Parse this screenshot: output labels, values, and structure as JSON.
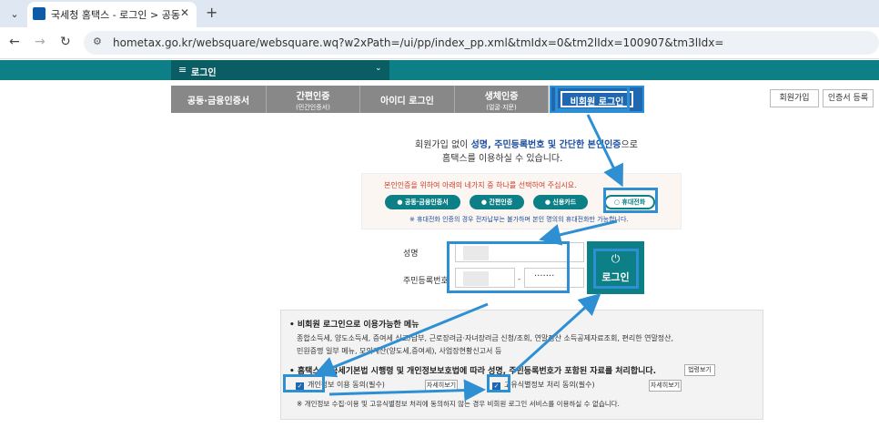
{
  "browser": {
    "tab_title": "국세청 홈택스 - 로그인 > 공동",
    "url": "hometax.go.kr/websquare/websquare.wq?w2xPath=/ui/pp/index_pp.xml&tmIdx=0&tm2lIdx=100907&tm3lIdx="
  },
  "header": {
    "menu_label": "로그인"
  },
  "login_tabs": [
    {
      "label": "공동·금융인증서",
      "sub": ""
    },
    {
      "label": "간편인증",
      "sub": "(민간인증서)"
    },
    {
      "label": "아이디 로그인",
      "sub": ""
    },
    {
      "label": "생체인증",
      "sub": "(얼굴·지문)"
    },
    {
      "label": "비회원 로그인",
      "sub": ""
    }
  ],
  "top_buttons": {
    "signup": "회원가입",
    "cert_register": "인증서 등록"
  },
  "intro": {
    "line1_prefix": "회원가입 없이 ",
    "line1_bold": "성명, 주민등록번호 및 간단한 본인인증",
    "line1_suffix": "으로",
    "line2": "홈택스를 이용하실 수 있습니다."
  },
  "auth": {
    "message": "본인인증을 위하여 아래의 네가지 중 하나를 선택하여 주십시요.",
    "options": [
      "공동·금융인증서",
      "간편인증",
      "신용카드",
      "휴대전화"
    ],
    "note": "※ 휴대전화 인증의 경우 전자납부는 불가하며 본인 명의의 휴대전화만 가능합니다."
  },
  "form": {
    "name_label": "성명",
    "rrn_label": "주민등록번호",
    "rrn_mask": "·······",
    "dash": "-",
    "login_button": "로그인"
  },
  "info": {
    "title": "• 비회원 로그인으로 이용가능한 메뉴",
    "line1": "종합소득세, 양도소득세, 증여세 신고/납부, 근로장려금·자녀장려금 신청/조회, 연말정산 소득공제자료조회, 편리한 연말정산,",
    "line2": "민원증명 일부 메뉴, 모의계산(양도세,증여세), 사업장현황신고서 등",
    "title2": "• 홈택스는 국세기본법 시행령 및 개인정보보호법에 따라 성명, 주민등록번호가 포함된 자료를 처리합니다.",
    "law_button": "법령보기",
    "consent1": "개인정보 이용 동의(필수)",
    "consent2": "고유식별정보 처리 동의(필수)",
    "detail_button": "자세히보기",
    "footer": "※ 개인정보 수집·이용 및 고유식별정보 처리에 동의하지 않는 경우 비회원 로그인 서비스를 이용하실 수 없습니다."
  }
}
